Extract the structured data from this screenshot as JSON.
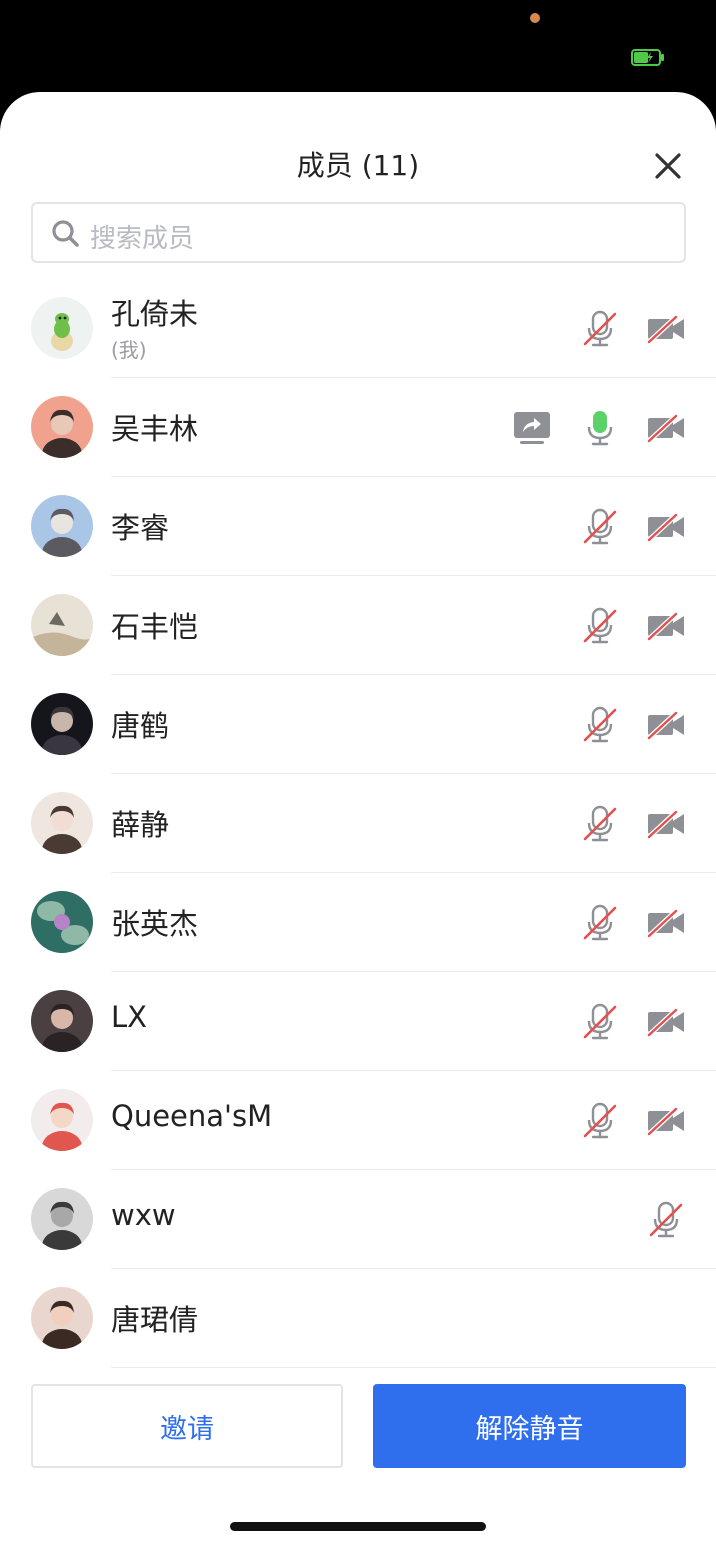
{
  "header": {
    "title": "成员 (11)",
    "close_icon": "close-icon"
  },
  "search": {
    "placeholder": "搜索成员",
    "icon": "search-icon"
  },
  "colors": {
    "accent": "#2f6fed",
    "muted_slash": "#e2504f",
    "active_mic": "#5bd16a",
    "icon_gray": "#8e9096"
  },
  "members": [
    {
      "name": "孔倚未",
      "subtitle": "(我)",
      "mic": "muted",
      "camera": "off",
      "sharing": false,
      "avatar_icon": "green-dinosaur-avatar"
    },
    {
      "name": "吴丰林",
      "subtitle": "",
      "mic": "active",
      "camera": "off",
      "sharing": true,
      "avatar_icon": "person-avatar"
    },
    {
      "name": "李睿",
      "subtitle": "",
      "mic": "muted",
      "camera": "off",
      "sharing": false,
      "avatar_icon": "person-avatar"
    },
    {
      "name": "石丰恺",
      "subtitle": "",
      "mic": "muted",
      "camera": "off",
      "sharing": false,
      "avatar_icon": "painting-avatar"
    },
    {
      "name": "唐鹤",
      "subtitle": "",
      "mic": "muted",
      "camera": "off",
      "sharing": false,
      "avatar_icon": "person-avatar"
    },
    {
      "name": "薛静",
      "subtitle": "",
      "mic": "muted",
      "camera": "off",
      "sharing": false,
      "avatar_icon": "cartoon-avatar"
    },
    {
      "name": "张英杰",
      "subtitle": "",
      "mic": "muted",
      "camera": "off",
      "sharing": false,
      "avatar_icon": "lotus-avatar"
    },
    {
      "name": "LX",
      "subtitle": "",
      "mic": "muted",
      "camera": "off",
      "sharing": false,
      "avatar_icon": "person-avatar"
    },
    {
      "name": "Queena'sM",
      "subtitle": "",
      "mic": "muted",
      "camera": "off",
      "sharing": false,
      "avatar_icon": "person-avatar"
    },
    {
      "name": "wxw",
      "subtitle": "",
      "mic": "muted",
      "camera": "none",
      "sharing": false,
      "avatar_icon": "person-avatar"
    },
    {
      "name": "唐珺倩",
      "subtitle": "",
      "mic": "none",
      "camera": "none",
      "sharing": false,
      "avatar_icon": "person-avatar"
    }
  ],
  "footer": {
    "invite_label": "邀请",
    "unmute_label": "解除静音"
  }
}
